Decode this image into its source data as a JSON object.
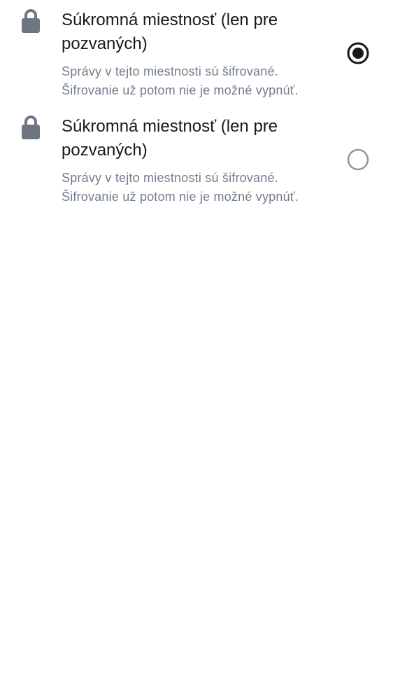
{
  "options": [
    {
      "title": "Súkromná miestnosť (len pre pozvaných)",
      "description": "Správy v tejto miestnosti sú šifrované. Šifrovanie už potom nie je možné vypnúť.",
      "selected": true,
      "icon": "lock-icon"
    },
    {
      "title": "Súkromná miestnosť (len pre pozvaných)",
      "description": "Správy v tejto miestnosti sú šifrované. Šifrovanie už potom nie je možné vypnúť.",
      "selected": false,
      "icon": "lock-icon"
    }
  ],
  "colors": {
    "title": "#17191c",
    "description": "#737d8c",
    "icon": "#6f7681",
    "radio_selected": "#17191c",
    "radio_unselected": "#8d97a5",
    "background": "#ffffff"
  }
}
